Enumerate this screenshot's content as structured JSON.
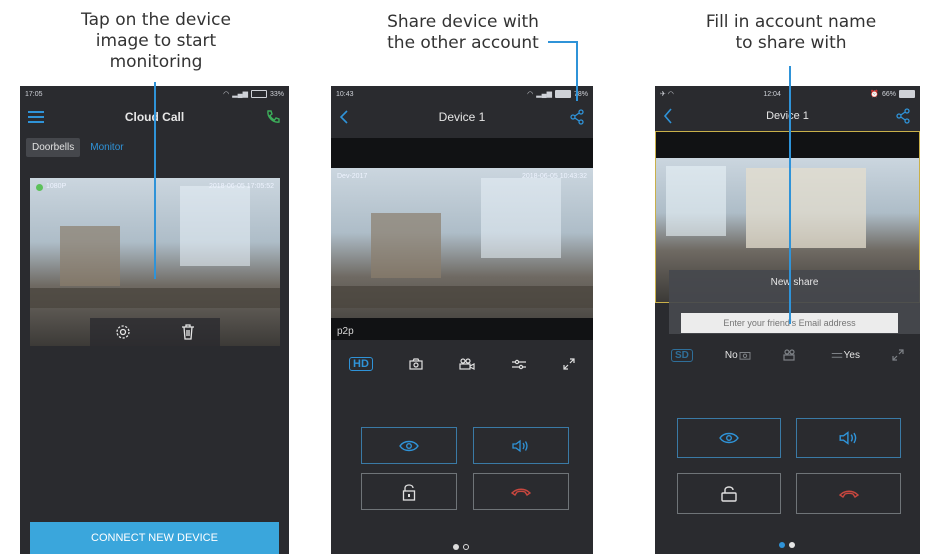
{
  "captions": {
    "left": [
      "Tap on the device",
      "image to start",
      "monitoring"
    ],
    "middle": [
      "Share device with",
      "the other account"
    ],
    "right": [
      "Fill in account name",
      "to share with"
    ]
  },
  "phone1": {
    "status_time": "17:05",
    "status_battery": "33%",
    "title": "Cloud Call",
    "tabs": [
      "Doorbells",
      "Monitor"
    ],
    "video_osd_left": "1080P",
    "video_osd_right": "2018-06-05 17:05:52",
    "connect_button": "CONNECT NEW DEVICE"
  },
  "phone2": {
    "status_time": "10:43",
    "status_battery": "78%",
    "title": "Device 1",
    "video_osd_left": "Dev-2017",
    "video_osd_right": "2018-06-05 10:43:32",
    "mode_label": "p2p",
    "hd_label": "HD"
  },
  "phone3": {
    "status_time": "12:04",
    "status_battery": "66%",
    "title": "Device 1",
    "dialog_title": "New share",
    "email_placeholder": "Enter your friend's Email address",
    "sd_label": "SD",
    "no_label": "No",
    "yes_label": "Yes"
  },
  "colors": {
    "accent": "#2f93d8",
    "phone_bg": "#2a2b2f",
    "call_green": "#3cae5a",
    "hangup_red": "#c9473f",
    "connect_button": "#3aa6dc"
  }
}
